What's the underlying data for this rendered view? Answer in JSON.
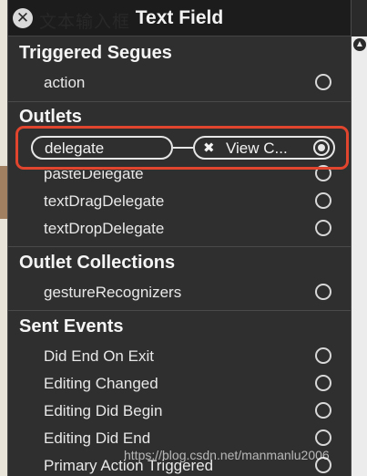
{
  "window": {
    "title": "Text Field",
    "ghost_title": "文本输入框"
  },
  "sections": {
    "triggered_segues": {
      "heading": "Triggered Segues",
      "rows": [
        {
          "label": "action"
        }
      ]
    },
    "outlets": {
      "heading": "Outlets",
      "rows": [
        {
          "label": "delegate",
          "connected": true,
          "target": "View C..."
        },
        {
          "label": "pasteDelegate"
        },
        {
          "label": "textDragDelegate"
        },
        {
          "label": "textDropDelegate"
        }
      ]
    },
    "outlet_collections": {
      "heading": "Outlet Collections",
      "rows": [
        {
          "label": "gestureRecognizers"
        }
      ]
    },
    "sent_events": {
      "heading": "Sent Events",
      "rows": [
        {
          "label": "Did End On Exit"
        },
        {
          "label": "Editing Changed"
        },
        {
          "label": "Editing Did Begin"
        },
        {
          "label": "Editing Did End"
        },
        {
          "label": "Primary Action Triggered"
        }
      ]
    }
  },
  "icons": {
    "close": "close-icon",
    "remove_connection": "remove-connection-icon",
    "scroll_up": "scroll-up-icon",
    "connection_well": "connection-well-icon"
  },
  "colors": {
    "highlight": "#e2452d",
    "panel": "#2f2f2f",
    "titlebar": "#1c1c1c"
  },
  "watermark": "https://blog.csdn.net/manmanlu2006"
}
